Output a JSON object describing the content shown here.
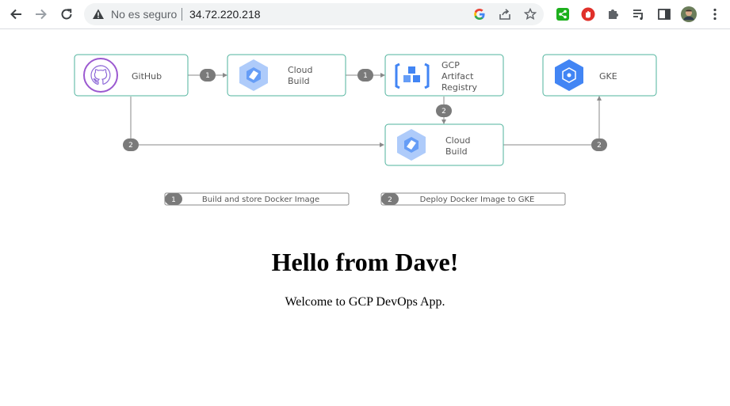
{
  "browser": {
    "security_label": "No es seguro",
    "url": "34.72.220.218",
    "icons": [
      "back-icon",
      "forward-icon",
      "reload-icon",
      "warning-icon",
      "google-icon",
      "share-icon",
      "bookmark-star-icon",
      "share-extension-icon",
      "adblock-icon",
      "extensions-puzzle-icon",
      "reading-list-icon",
      "side-panel-icon",
      "profile-avatar",
      "menu-kebab-icon"
    ],
    "colors": {
      "share_ext": "#1db01d",
      "adblock": "#e0302a",
      "accent_blue": "#4285f4"
    }
  },
  "diagram": {
    "nodes": {
      "github": "GitHub",
      "cloud_build_top": [
        "Cloud",
        "Build"
      ],
      "artifact_registry": [
        "GCP",
        "Artifact",
        "Registry"
      ],
      "gke": "GKE",
      "cloud_build_bottom": [
        "Cloud",
        "Build"
      ]
    },
    "step_badges": {
      "one": "1",
      "two": "2"
    },
    "legend": [
      {
        "num": "1",
        "label": "Build and store Docker Image"
      },
      {
        "num": "2",
        "label": "Deploy Docker Image to GKE"
      }
    ],
    "colors": {
      "node_border": "#4fb39c",
      "badge": "#7a7a7a",
      "line": "#8a8a8a",
      "product_blue": "#aecbfa",
      "gke_blue": "#4285f4"
    }
  },
  "page": {
    "heading": "Hello from Dave!",
    "message": "Welcome to GCP DevOps App."
  }
}
